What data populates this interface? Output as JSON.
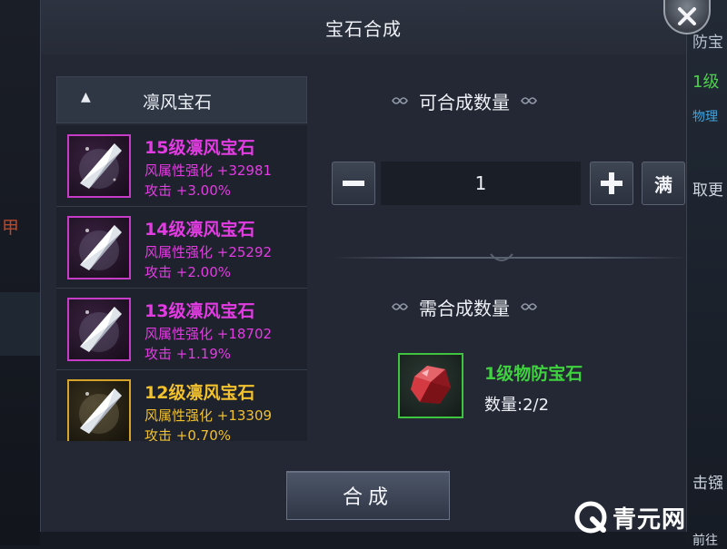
{
  "background": {
    "left_fragment": "甲",
    "right_fragments": [
      "防宝",
      "1级",
      "物理",
      "取更",
      "击镪",
      "前往"
    ]
  },
  "modal": {
    "title": "宝石合成",
    "close_icon": "close-icon"
  },
  "gem_list": {
    "header_label": "凛风宝石",
    "header_icon": "triangle-up-icon",
    "items": [
      {
        "name": "15级凛风宝石",
        "attr": "风属性强化 +32981",
        "atk": "攻击 +3.00%",
        "color": "#e23ce2",
        "frame": "purple"
      },
      {
        "name": "14级凛风宝石",
        "attr": "风属性强化 +25292",
        "atk": "攻击 +2.00%",
        "color": "#e23ce2",
        "frame": "purple"
      },
      {
        "name": "13级凛风宝石",
        "attr": "风属性强化 +18702",
        "atk": "攻击 +1.19%",
        "color": "#e23ce2",
        "frame": "purple"
      },
      {
        "name": "12级凛风宝石",
        "attr": "风属性强化 +13309",
        "atk": "攻击 +0.70%",
        "color": "#f2c12e",
        "frame": "gold"
      }
    ]
  },
  "craft": {
    "count_title": "可合成数量",
    "quantity": "1",
    "minus_icon": "minus-icon",
    "plus_icon": "plus-icon",
    "max_label": "满",
    "required_title": "需合成数量",
    "material": {
      "name": "1级物防宝石",
      "count": "数量:2/2",
      "icon": "red-gem-icon"
    },
    "confirm_label": "合成"
  },
  "watermark": {
    "text": "青元网",
    "icon": "q-logo-icon"
  }
}
